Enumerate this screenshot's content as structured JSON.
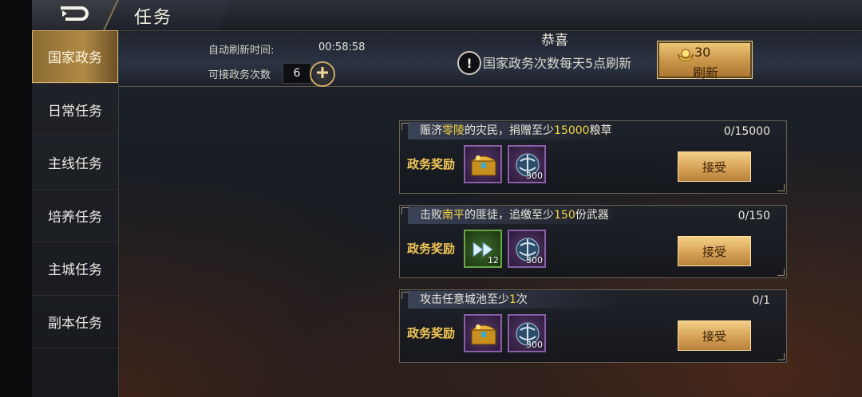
{
  "header": {
    "title": "任务",
    "back_icon": "back-arrow-icon"
  },
  "sidebar": {
    "items": [
      {
        "label": "国家政务",
        "active": true
      },
      {
        "label": "日常任务",
        "active": false
      },
      {
        "label": "主线任务",
        "active": false
      },
      {
        "label": "培养任务",
        "active": false
      },
      {
        "label": "主城任务",
        "active": false
      },
      {
        "label": "副本任务",
        "active": false
      }
    ]
  },
  "info": {
    "auto_refresh_label": "自动刷新时间:",
    "auto_refresh_time": "00:58:58",
    "count_label": "可接政务次数",
    "count_value": "6",
    "congrats": "恭喜",
    "notice": "国家政务次数每天5点刷新"
  },
  "refresh": {
    "cost": "30",
    "label": "刷新"
  },
  "tasks": [
    {
      "title_parts": [
        "赈济",
        "零陵",
        "的灾民，捐赠至少",
        "15000",
        "粮草"
      ],
      "progress": "0/15000",
      "reward_label": "政务奖励",
      "rewards": [
        {
          "icon": "treasure-chest-icon",
          "qty": ""
        },
        {
          "icon": "orb-icon",
          "qty": "300"
        }
      ],
      "button": "接受"
    },
    {
      "title_parts": [
        "击败",
        "南平",
        "的匪徒，追缴至少",
        "150",
        "份武器"
      ],
      "progress": "0/150",
      "reward_label": "政务奖励",
      "rewards": [
        {
          "icon": "fast-forward-icon",
          "qty": "12"
        },
        {
          "icon": "orb-icon",
          "qty": "300"
        }
      ],
      "button": "接受"
    },
    {
      "title_parts": [
        "攻击任意城池至少",
        "1",
        "次"
      ],
      "progress": "0/1",
      "reward_label": "政务奖励",
      "rewards": [
        {
          "icon": "treasure-chest-icon",
          "qty": ""
        },
        {
          "icon": "orb-icon",
          "qty": "300"
        }
      ],
      "button": "接受"
    }
  ]
}
